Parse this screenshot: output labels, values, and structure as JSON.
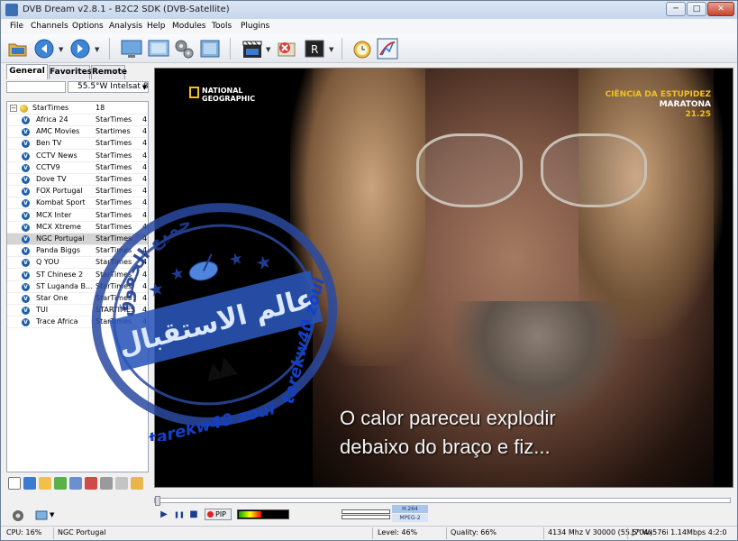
{
  "window": {
    "title": "DVB Dream v2.8.1 - B2C2 SDK (DVB-Satellite)",
    "minimize": "─",
    "maximize": "□",
    "close": "✕"
  },
  "menu": [
    "File",
    "Channels",
    "Options",
    "Analysis",
    "Help",
    "Modules",
    "Tools",
    "Plugins"
  ],
  "tabs": [
    "General",
    "Favorites",
    "Remote"
  ],
  "satellite": "55.5°W Intelsat 8",
  "group": {
    "name": "StarTimes",
    "count": "18"
  },
  "channels": [
    {
      "name": "Africa 24",
      "provider": "StarTimes",
      "num": "4"
    },
    {
      "name": "AMC Movies",
      "provider": "Startimes",
      "num": "4"
    },
    {
      "name": "Ben TV",
      "provider": "StarTimes",
      "num": "4"
    },
    {
      "name": "CCTV News",
      "provider": "StarTimes",
      "num": "4"
    },
    {
      "name": "CCTV9",
      "provider": "StarTimes",
      "num": "4"
    },
    {
      "name": "Dove TV",
      "provider": "StarTimes",
      "num": "4"
    },
    {
      "name": "FOX Portugal",
      "provider": "StarTimes",
      "num": "4"
    },
    {
      "name": "Kombat Sport",
      "provider": "StarTimes",
      "num": "4"
    },
    {
      "name": "MCX Inter",
      "provider": "StarTimes",
      "num": "4"
    },
    {
      "name": "MCX Xtreme",
      "provider": "StarTimes",
      "num": "4"
    },
    {
      "name": "NGC Portugal",
      "provider": "StarTimes",
      "num": "4"
    },
    {
      "name": "Panda Biggs",
      "provider": "StarTimes",
      "num": "4"
    },
    {
      "name": "Q YOU",
      "provider": "StarTimes",
      "num": "4"
    },
    {
      "name": "ST Chinese 2",
      "provider": "StarTimes",
      "num": "4"
    },
    {
      "name": "ST Luganda B...",
      "provider": "StarTimes",
      "num": "4"
    },
    {
      "name": "Star One",
      "provider": "StarTimes",
      "num": "4"
    },
    {
      "name": "TUI",
      "provider": "STARTIMES",
      "num": "4"
    },
    {
      "name": "Trace Africa",
      "provider": "StarTimes",
      "num": "4"
    }
  ],
  "selected_channel": "NGC Portugal",
  "video": {
    "logo_line1": "NATIONAL",
    "logo_line2": "GEOGRAPHIC",
    "program_title": "CIÊNCIA DA ESTUPIDEZ",
    "program_subtitle": "MARATONA",
    "program_time": "21.25",
    "subtitle_line1": "O calor pareceu explodir",
    "subtitle_line2": "debaixo do braço e fiz..."
  },
  "watermark": {
    "arabic_top": "جميع الحقوق",
    "arabic_main": "عالم الاستقبال",
    "latin_1": "tarekw40 zoui",
    "latin_2": "tarekw40 zoui"
  },
  "controls": {
    "play": "▶",
    "pause": "❚❚",
    "stop": "■",
    "pip": "PIP",
    "level_percent": 46,
    "codec_video": "H.264",
    "codec_audio": "MPEG-2"
  },
  "status": {
    "cpu": "CPU: 16%",
    "channel": "NGC Portugal",
    "level": "Level: 46%",
    "quality": "Quality: 66%",
    "tuning": "4134 Mhz  V  30000  (55.5° W)",
    "video_info": "[704x576i  1.14Mbps 4:2:0"
  },
  "colors": {
    "accent": "#1d5fa8",
    "stamp_blue": "#2a4aa0",
    "caption_yellow": "#f2c21b"
  }
}
